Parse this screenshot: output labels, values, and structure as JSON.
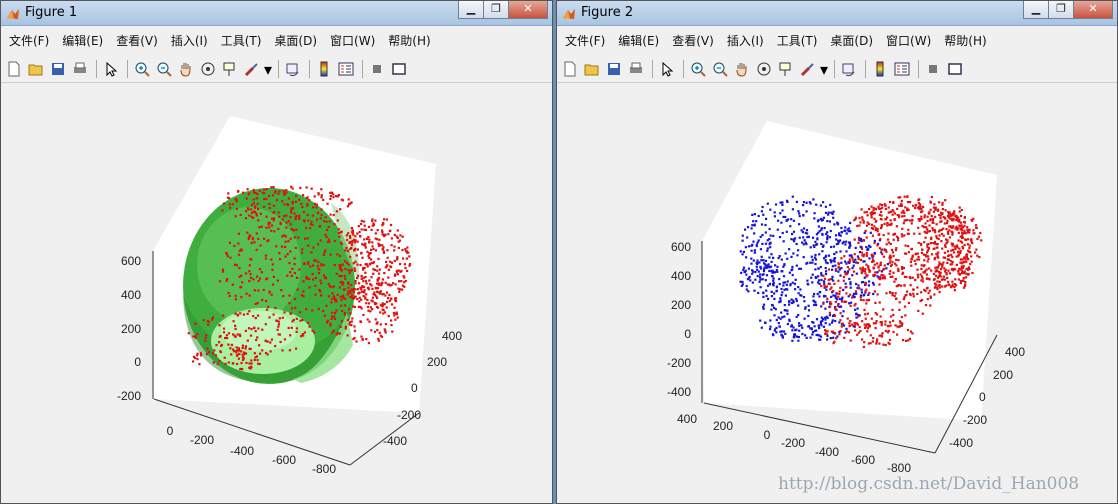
{
  "figure1": {
    "title": "Figure 1",
    "window_buttons": [
      "minimize",
      "restore",
      "close"
    ],
    "menu": [
      "文件(F)",
      "编辑(E)",
      "查看(V)",
      "插入(I)",
      "工具(T)",
      "桌面(D)",
      "窗口(W)",
      "帮助(H)"
    ],
    "toolbar": [
      "new-figure",
      "open-file",
      "save",
      "print",
      "edit-plot",
      "zoom-in",
      "zoom-out",
      "pan",
      "rotate-3d",
      "data-cursor",
      "brush",
      "link-plot",
      "colorbar",
      "legend",
      "hide-plot-tools",
      "show-plot-tools"
    ],
    "z_ticks": [
      "600",
      "400",
      "200",
      "0",
      "-200"
    ],
    "y_ticks": [
      "400",
      "200",
      "0",
      "-200",
      "-400"
    ],
    "x_ticks": [
      "0",
      "-200",
      "-400",
      "-600",
      "-800"
    ]
  },
  "figure2": {
    "title": "Figure 2",
    "window_buttons": [
      "minimize",
      "restore",
      "close"
    ],
    "menu": [
      "文件(F)",
      "编辑(E)",
      "查看(V)",
      "插入(I)",
      "工具(T)",
      "桌面(D)",
      "窗口(W)",
      "帮助(H)"
    ],
    "toolbar": [
      "new-figure",
      "open-file",
      "save",
      "print",
      "edit-plot",
      "zoom-in",
      "zoom-out",
      "pan",
      "rotate-3d",
      "data-cursor",
      "brush",
      "link-plot",
      "colorbar",
      "legend",
      "hide-plot-tools",
      "show-plot-tools"
    ],
    "z_ticks": [
      "600",
      "400",
      "200",
      "0",
      "-200",
      "-400"
    ],
    "y_ticks": [
      "400",
      "200",
      "0",
      "-200",
      "-400"
    ],
    "x_ticks": [
      "400",
      "200",
      "0",
      "-200",
      "-400",
      "-600",
      "-800"
    ]
  },
  "watermark": "http://blog.csdn.net/David_Han008",
  "colors": {
    "red_points": "#e01010",
    "blue_points": "#1414d8",
    "surface": "#3fae3f"
  }
}
